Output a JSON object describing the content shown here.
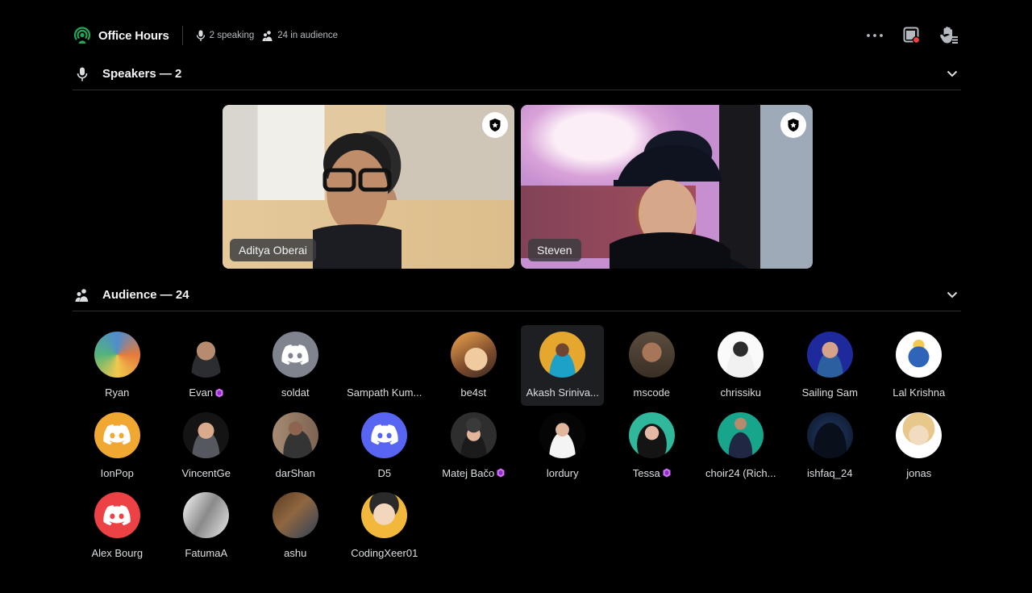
{
  "header": {
    "title": "Office Hours",
    "speaking": "2 speaking",
    "audience_count": "24 in audience",
    "accent_color": "#23a55a",
    "icons": [
      "stage-icon",
      "microphone-icon",
      "audience-icon",
      "more-options-icon",
      "screen-share-icon",
      "raise-hand-icon"
    ]
  },
  "speakers_section": {
    "title": "Speakers — 2",
    "speakers": [
      {
        "name": "Aditya Oberai",
        "badge": "moderator-shield-icon"
      },
      {
        "name": "Steven",
        "badge": "moderator-shield-icon"
      }
    ]
  },
  "audience_section": {
    "title": "Audience — 24",
    "members": [
      {
        "name": "Ryan",
        "avatar": "av-ryan",
        "boost": false
      },
      {
        "name": "Evan",
        "avatar": "av-evan",
        "boost": true
      },
      {
        "name": "soldat",
        "avatar": "discord-default",
        "avatar_color": "#80848e",
        "boost": false
      },
      {
        "name": "Sampath Kum...",
        "avatar": "av-blank",
        "boost": false
      },
      {
        "name": "be4st",
        "avatar": "av-be4st",
        "boost": false
      },
      {
        "name": "Akash Sriniva...",
        "avatar": "av-akash",
        "boost": false,
        "highlighted": true
      },
      {
        "name": "mscode",
        "avatar": "av-mscode",
        "boost": false
      },
      {
        "name": "chrissiku",
        "avatar": "av-chrissiku",
        "boost": false
      },
      {
        "name": "Sailing Sam",
        "avatar": "av-sam",
        "boost": false
      },
      {
        "name": "Lal Krishna",
        "avatar": "av-lal",
        "boost": false
      },
      {
        "name": "IonPop",
        "avatar": "discord-default",
        "avatar_color": "#f0a832",
        "boost": false
      },
      {
        "name": "VincentGe",
        "avatar": "av-vincent",
        "boost": false
      },
      {
        "name": "darShan",
        "avatar": "av-darshan",
        "boost": false
      },
      {
        "name": "D5",
        "avatar": "discord-default",
        "avatar_color": "#5865f2",
        "boost": false
      },
      {
        "name": "Matej Bačo",
        "avatar": "av-matej",
        "boost": true
      },
      {
        "name": "lordury",
        "avatar": "av-lordury",
        "boost": false
      },
      {
        "name": "Tessa",
        "avatar": "av-tessa",
        "boost": true
      },
      {
        "name": "choir24 (Rich...",
        "avatar": "av-choir",
        "boost": false
      },
      {
        "name": "ishfaq_24",
        "avatar": "av-ishfaq",
        "boost": false
      },
      {
        "name": "jonas",
        "avatar": "av-jonas",
        "boost": false
      },
      {
        "name": "Alex Bourg",
        "avatar": "discord-default",
        "avatar_color": "#ed4245",
        "boost": false
      },
      {
        "name": "FatumaA",
        "avatar": "av-fatuma",
        "boost": false
      },
      {
        "name": "ashu",
        "avatar": "av-ashu",
        "boost": false
      },
      {
        "name": "CodingXeer01",
        "avatar": "av-coding",
        "boost": false
      }
    ]
  }
}
